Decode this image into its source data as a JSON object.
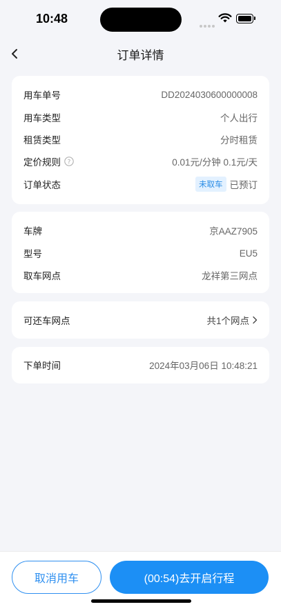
{
  "status_bar": {
    "time": "10:48"
  },
  "nav": {
    "title": "订单详情"
  },
  "order_card": {
    "order_no": {
      "label": "用车单号",
      "value": "DD2024030600000008"
    },
    "car_use_type": {
      "label": "用车类型",
      "value": "个人出行"
    },
    "rental_type": {
      "label": "租赁类型",
      "value": "分时租赁"
    },
    "pricing_rule": {
      "label": "定价规则",
      "value": "0.01元/分钟 0.1元/天"
    },
    "order_status": {
      "label": "订单状态",
      "tag": "未取车",
      "value": "已预订"
    }
  },
  "car_card": {
    "plate": {
      "label": "车牌",
      "value": "京AAZ7905"
    },
    "model": {
      "label": "型号",
      "value": "EU5"
    },
    "pickup_point": {
      "label": "取车网点",
      "value": "龙祥第三网点"
    }
  },
  "return_card": {
    "label": "可还车网点",
    "value": "共1个网点"
  },
  "time_card": {
    "label": "下单时间",
    "value": "2024年03月06日 10:48:21"
  },
  "actions": {
    "cancel_label": "取消用车",
    "start_label": "(00:54)去开启行程"
  },
  "colors": {
    "accent": "#1c8ff5",
    "tag_bg": "#e3f1ff",
    "page_bg": "#f4f5f9"
  }
}
